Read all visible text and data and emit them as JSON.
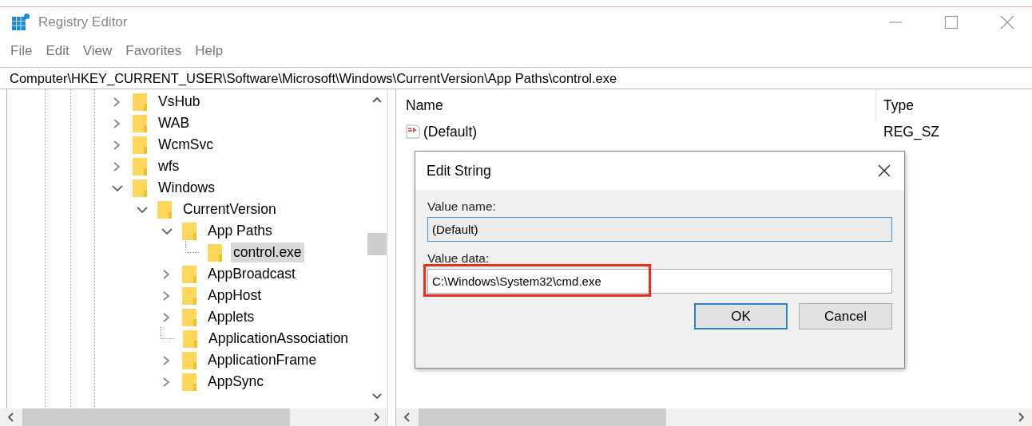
{
  "window": {
    "title": "Registry Editor"
  },
  "menu": [
    "File",
    "Edit",
    "View",
    "Favorites",
    "Help"
  ],
  "address": "Computer\\HKEY_CURRENT_USER\\Software\\Microsoft\\Windows\\CurrentVersion\\App Paths\\control.exe",
  "tree": [
    {
      "label": "VsHub",
      "kind": "folder",
      "expanded": false,
      "selected": false
    },
    {
      "label": "WAB",
      "kind": "folder",
      "expanded": false,
      "selected": false
    },
    {
      "label": "WcmSvc",
      "kind": "folder",
      "expanded": false,
      "selected": false
    },
    {
      "label": "wfs",
      "kind": "folder",
      "expanded": false,
      "selected": false
    },
    {
      "label": "Windows",
      "kind": "folder",
      "expanded": true,
      "selected": false,
      "children": [
        {
          "label": "CurrentVersion",
          "kind": "folder",
          "expanded": true,
          "selected": false,
          "children": [
            {
              "label": "App Paths",
              "kind": "folder",
              "expanded": true,
              "selected": false,
              "children": [
                {
                  "label": "control.exe",
                  "kind": "leaf",
                  "selected": true
                }
              ]
            },
            {
              "label": "AppBroadcast",
              "kind": "folder",
              "expanded": false,
              "selected": false
            },
            {
              "label": "AppHost",
              "kind": "folder",
              "expanded": false,
              "selected": false
            },
            {
              "label": "Applets",
              "kind": "folder",
              "expanded": false,
              "selected": false
            },
            {
              "label": "ApplicationAssociation",
              "kind": "leaf",
              "selected": false
            },
            {
              "label": "ApplicationFrame",
              "kind": "folder",
              "expanded": false,
              "selected": false
            },
            {
              "label": "AppSync",
              "kind": "folder",
              "expanded": false,
              "selected": false
            }
          ]
        }
      ]
    }
  ],
  "list": {
    "columns": [
      "Name",
      "Type"
    ],
    "rows": [
      {
        "name": "(Default)",
        "type": "REG_SZ"
      }
    ]
  },
  "dialog": {
    "title": "Edit String",
    "fields": [
      {
        "label": "Value name:",
        "value": "(Default)",
        "focused": true
      },
      {
        "label": "Value data:",
        "value": "C:\\Windows\\System32\\cmd.exe",
        "focused": false,
        "highlighted": true
      }
    ],
    "buttons": [
      {
        "label": "OK",
        "default": true
      },
      {
        "label": "Cancel",
        "default": false
      }
    ]
  }
}
